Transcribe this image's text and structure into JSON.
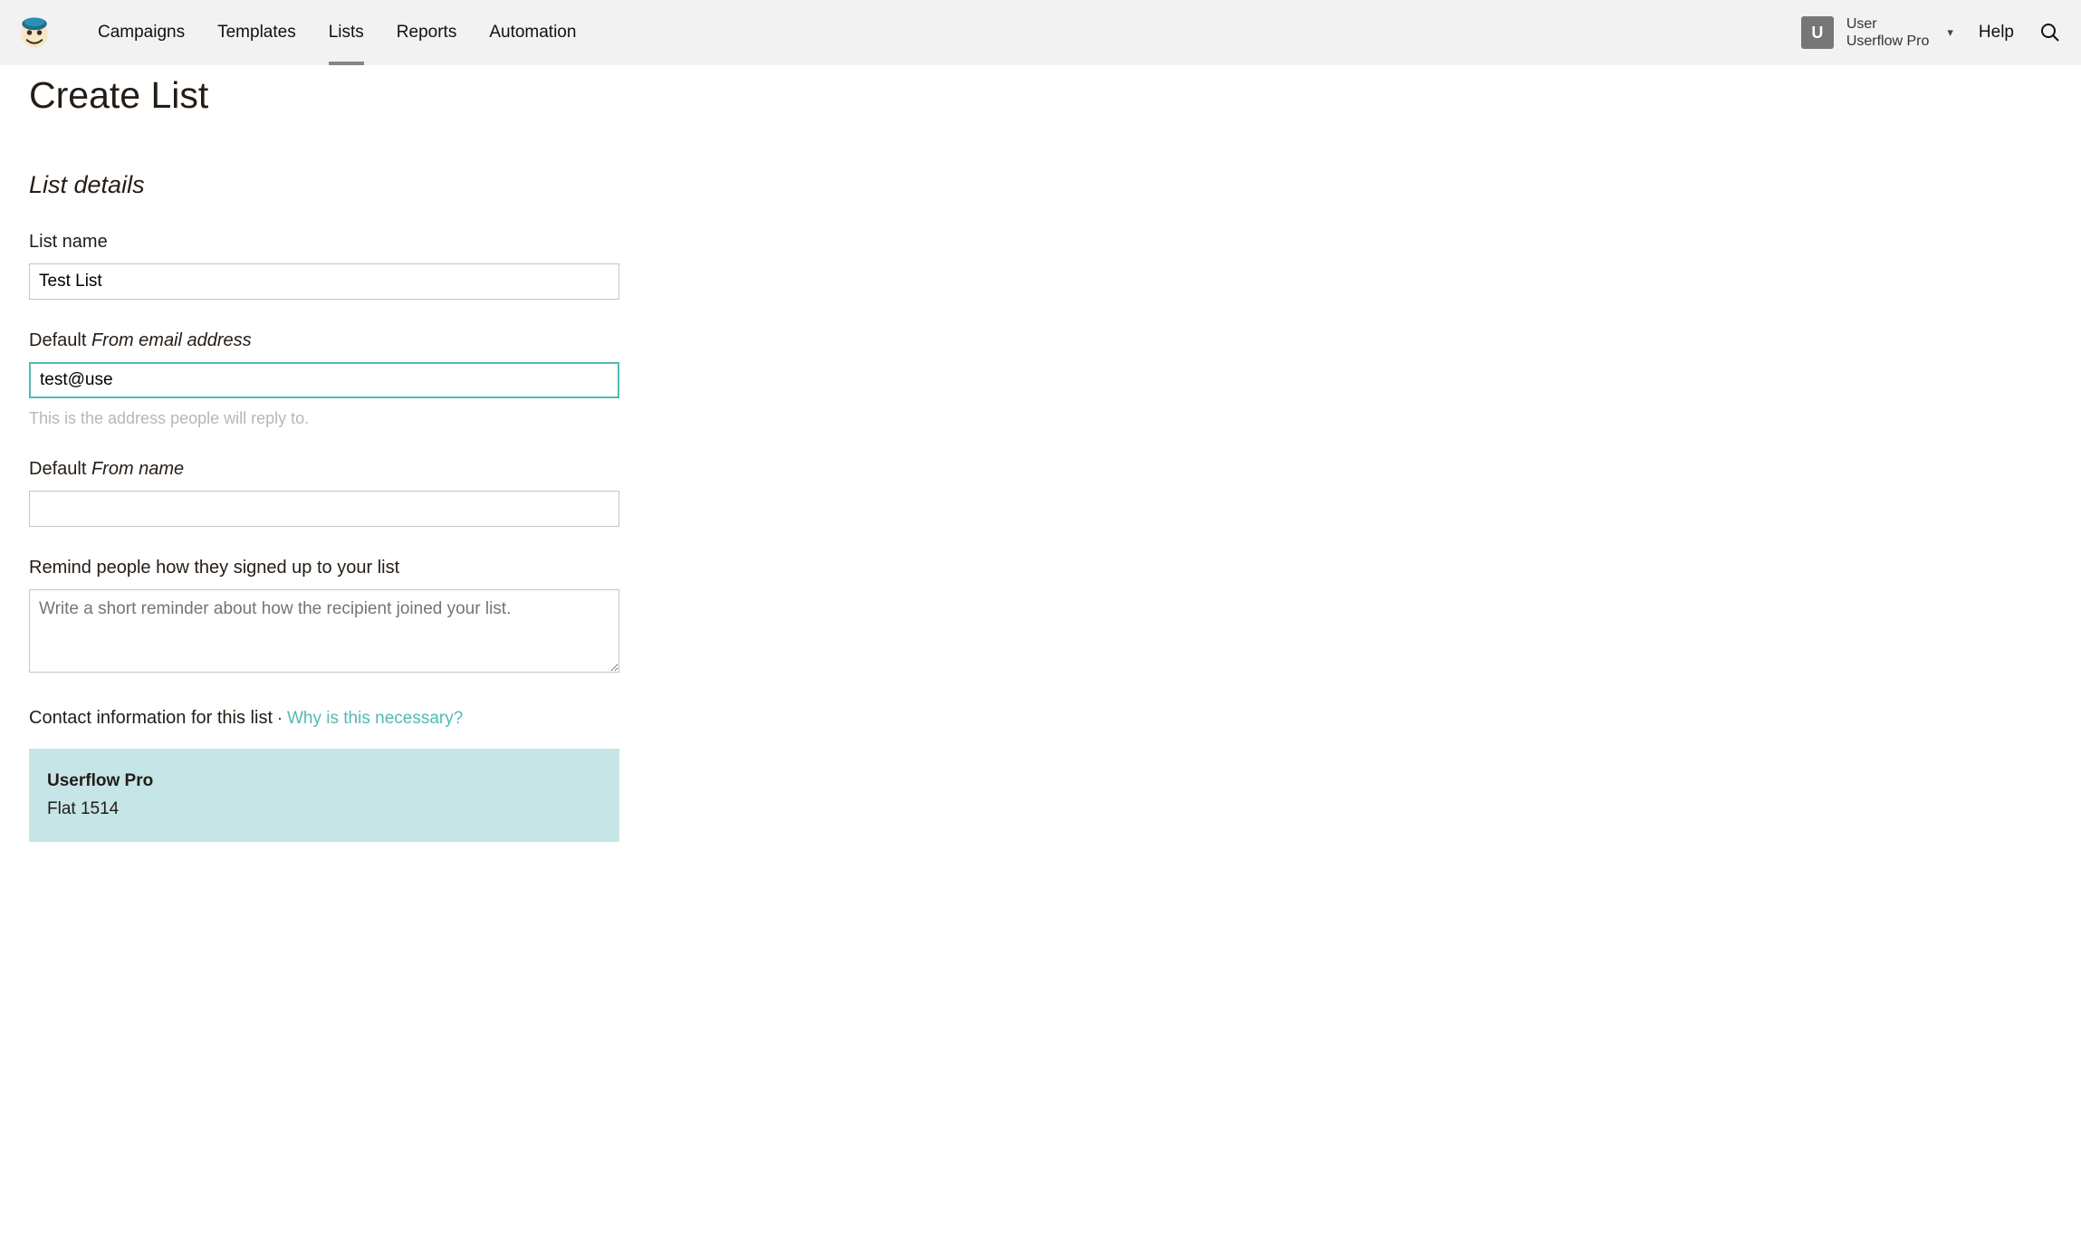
{
  "nav": {
    "items": [
      {
        "label": "Campaigns",
        "active": false
      },
      {
        "label": "Templates",
        "active": false
      },
      {
        "label": "Lists",
        "active": true
      },
      {
        "label": "Reports",
        "active": false
      },
      {
        "label": "Automation",
        "active": false
      }
    ]
  },
  "user": {
    "avatar_letter": "U",
    "name": "User",
    "org": "Userflow Pro"
  },
  "help_label": "Help",
  "page": {
    "title": "Create List",
    "section_title": "List details"
  },
  "fields": {
    "list_name": {
      "label": "List name",
      "value": "Test List"
    },
    "from_email": {
      "label_prefix": "Default ",
      "label_italic": "From email address",
      "value": "test@use",
      "helper": "This is the address people will reply to."
    },
    "from_name": {
      "label_prefix": "Default ",
      "label_italic": "From name",
      "value": ""
    },
    "reminder": {
      "label": "Remind people how they signed up to your list",
      "placeholder": "Write a short reminder about how the recipient joined your list.",
      "value": ""
    }
  },
  "contact": {
    "header": "Contact information for this list",
    "dot": " · ",
    "why": "Why is this necessary?",
    "org": "Userflow Pro",
    "line1": "Flat 1514"
  }
}
